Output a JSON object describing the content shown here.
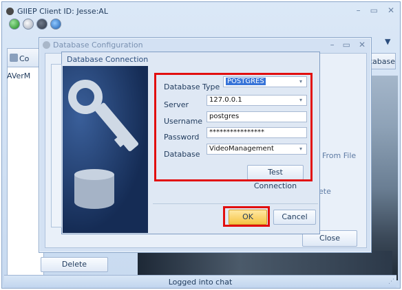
{
  "main_window": {
    "title": "GIIEP Client ID: Jesse:AL",
    "left_tab_label": "Co",
    "left_list_item": "AVerM",
    "right_tab_label": "atabase",
    "delete_label": "Delete",
    "status": "Logged into chat"
  },
  "db_config": {
    "title": "Database Configuration",
    "from_file_label": "From File",
    "side_text": "ete",
    "close_label": "Close"
  },
  "db_connection": {
    "title": "Database Connection",
    "labels": {
      "type": "Database Type",
      "server": "Server",
      "username": "Username",
      "password": "Password",
      "database": "Database"
    },
    "values": {
      "type": "POSTGRES",
      "server": "127.0.0.1",
      "username": "postgres",
      "password": "****************",
      "database": "VideoManagement"
    },
    "test_label": "Test Connection",
    "ok_label": "OK",
    "cancel_label": "Cancel"
  },
  "colors": {
    "highlight_frame": "#e20e0e",
    "ok_button": "#f5c444",
    "selection": "#3874d8"
  },
  "icons": [
    "app-icon",
    "connect-icon",
    "settings-icon",
    "logout-icon",
    "help-icon",
    "key-illustration",
    "database-cylinder"
  ]
}
